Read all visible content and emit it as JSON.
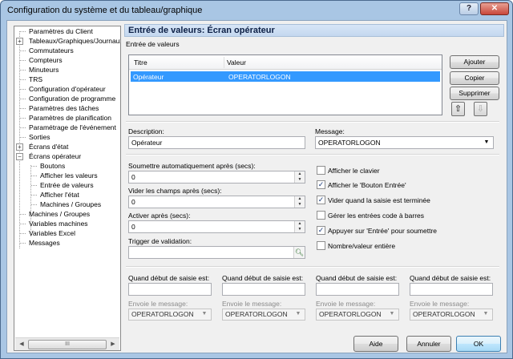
{
  "window": {
    "title": "Configuration du système et du tableau/graphique",
    "help_glyph": "?",
    "close_glyph": "✕"
  },
  "tree": {
    "items": [
      {
        "label": "Paramètres du Client"
      },
      {
        "label": "Tableaux/Graphiques/Journaux"
      },
      {
        "label": "Commutateurs"
      },
      {
        "label": "Compteurs"
      },
      {
        "label": "Minuteurs"
      },
      {
        "label": "TRS"
      },
      {
        "label": "Configuration d'opérateur"
      },
      {
        "label": "Configuration de programme"
      },
      {
        "label": "Paramètres des tâches"
      },
      {
        "label": "Paramètres de planification"
      },
      {
        "label": "Paramétrage de l'événement"
      },
      {
        "label": "Sorties"
      },
      {
        "label": "Écrans d'état"
      },
      {
        "label": "Écrans opérateur"
      },
      {
        "label": "Boutons"
      },
      {
        "label": "Afficher les valeurs"
      },
      {
        "label": "Entrée de valeurs"
      },
      {
        "label": "Afficher l'état"
      },
      {
        "label": "Machines / Groupes"
      },
      {
        "label": "Machines / Groupes"
      },
      {
        "label": "Variables machines"
      },
      {
        "label": "Variables Excel"
      },
      {
        "label": "Messages"
      }
    ],
    "expand_plus": "+",
    "expand_minus": "−",
    "scroll_thumb": "III"
  },
  "panel": {
    "title": "Entrée de valeurs: Écran opérateur",
    "group_label": "Entrée de valeurs",
    "list": {
      "col_title": "Titre",
      "col_value": "Valeur",
      "rows": [
        {
          "title": "Opérateur",
          "value": "OPERATORLOGON"
        }
      ]
    },
    "buttons": {
      "add": "Ajouter",
      "copy": "Copier",
      "delete": "Supprimer"
    },
    "description_label": "Description:",
    "description_value": "Opérateur",
    "message_label": "Message:",
    "message_value": "OPERATORLOGON",
    "auto_submit_label": "Soumettre automatiquement après (secs):",
    "auto_submit_value": "0",
    "clear_fields_label": "Vider les champs après (secs):",
    "clear_fields_value": "0",
    "activate_label": "Activer après (secs):",
    "activate_value": "0",
    "trigger_label": "Trigger de validation:",
    "trigger_value": "",
    "checkboxes": [
      {
        "label": "Afficher le clavier",
        "checked": false
      },
      {
        "label": "Afficher le 'Bouton Entrée'",
        "checked": true
      },
      {
        "label": "Vider quand la saisie est terminée",
        "checked": true
      },
      {
        "label": "Gérer les entrées code à barres",
        "checked": false
      },
      {
        "label": "Appuyer sur 'Entrée' pour soumettre",
        "checked": true
      },
      {
        "label": "Nombre/valeur entière",
        "checked": false
      }
    ],
    "entry_start_columns": [
      {
        "label": "Quand début de saisie est:",
        "send_label": "Envoie le message:",
        "send_value": "OPERATORLOGON"
      },
      {
        "label": "Quand début de saisie est:",
        "send_label": "Envoie le message:",
        "send_value": "OPERATORLOGON"
      },
      {
        "label": "Quand début de saisie est:",
        "send_label": "Envoie le message:",
        "send_value": "OPERATORLOGON"
      },
      {
        "label": "Quand début de saisie est:",
        "send_label": "Envoie le message:",
        "send_value": "OPERATORLOGON"
      }
    ]
  },
  "footer": {
    "help": "Aide",
    "cancel": "Annuler",
    "ok": "OK"
  }
}
